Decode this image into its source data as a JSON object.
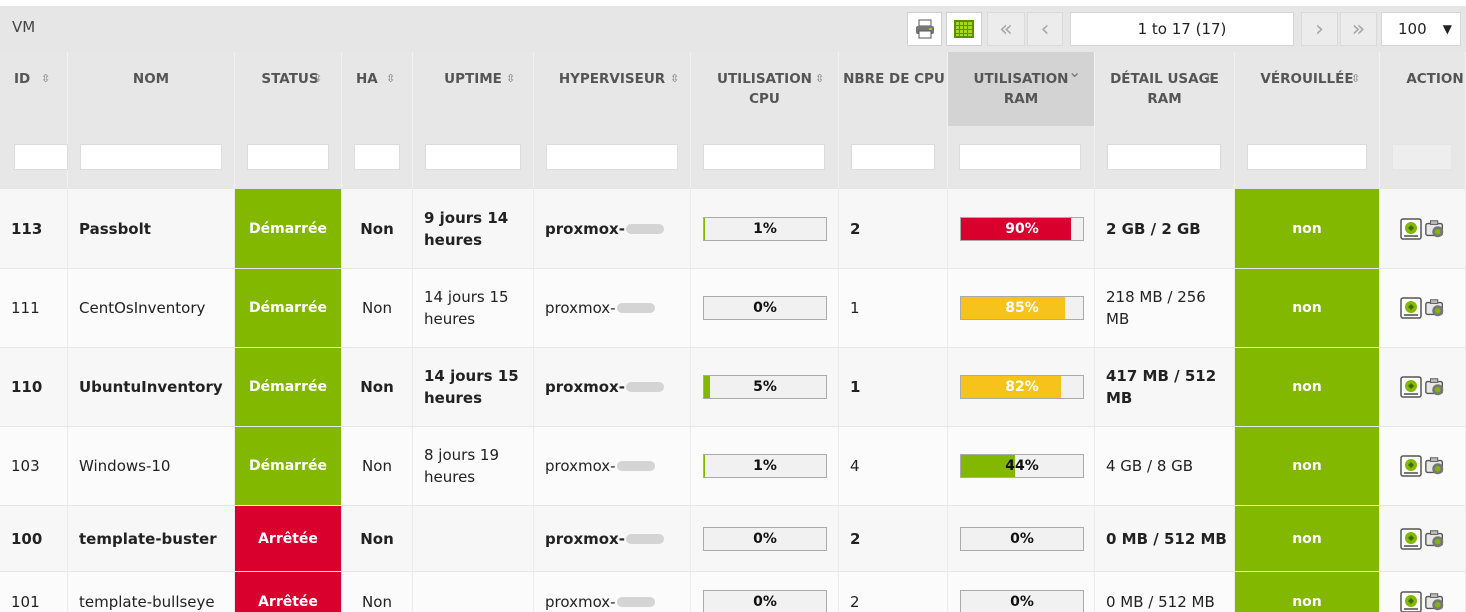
{
  "panel": {
    "title": "VM"
  },
  "toolbar": {
    "pager_text": "1 to 17 (17)",
    "per_page": "100",
    "icons": [
      "print-icon",
      "columns-icon",
      "first-page-icon",
      "prev-page-icon",
      "next-page-icon",
      "last-page-icon"
    ]
  },
  "columns": [
    {
      "label": "ID",
      "sortable": true
    },
    {
      "label": "NOM",
      "sortable": true
    },
    {
      "label": "STATUS",
      "sortable": true
    },
    {
      "label": "HA",
      "sortable": true
    },
    {
      "label": "UPTIME",
      "sortable": true
    },
    {
      "label": "HYPERVISEUR",
      "sortable": true
    },
    {
      "label": "UTILISATION CPU",
      "sortable": true
    },
    {
      "label": "NBRE DE CPU",
      "sortable": false
    },
    {
      "label": "UTILISATION RAM",
      "sortable": true,
      "sorted": "desc"
    },
    {
      "label": "DÉTAIL USAGE RAM",
      "sortable": true
    },
    {
      "label": "VÉROUILLÉE",
      "sortable": true
    },
    {
      "label": "ACTION",
      "sortable": false
    }
  ],
  "colors": {
    "green": "#82b800",
    "red": "#d9002d",
    "yellow": "#f7c31a"
  },
  "rows": [
    {
      "id": "113",
      "name": "Passbolt",
      "status": "Démarrée",
      "ha": "Non",
      "uptime": "9 jours 14 heures",
      "hypervisor": "proxmox-",
      "cpu_pct": 1,
      "cpu_label": "1%",
      "cpu_count": "2",
      "ram_pct": 90,
      "ram_label": "90%",
      "ram_detail": "2 GB / 2 GB",
      "locked": "non",
      "bold": true
    },
    {
      "id": "111",
      "name": "CentOsInventory",
      "status": "Démarrée",
      "ha": "Non",
      "uptime": "14 jours 15 heures",
      "hypervisor": "proxmox-",
      "cpu_pct": 0,
      "cpu_label": "0%",
      "cpu_count": "1",
      "ram_pct": 85,
      "ram_label": "85%",
      "ram_detail": "218 MB / 256 MB",
      "locked": "non",
      "bold": false
    },
    {
      "id": "110",
      "name": "UbuntuInventory",
      "status": "Démarrée",
      "ha": "Non",
      "uptime": "14 jours 15 heures",
      "hypervisor": "proxmox-",
      "cpu_pct": 5,
      "cpu_label": "5%",
      "cpu_count": "1",
      "ram_pct": 82,
      "ram_label": "82%",
      "ram_detail": "417 MB / 512 MB",
      "locked": "non",
      "bold": true
    },
    {
      "id": "103",
      "name": "Windows-10",
      "status": "Démarrée",
      "ha": "Non",
      "uptime": "8 jours 19 heures",
      "hypervisor": "proxmox-",
      "cpu_pct": 1,
      "cpu_label": "1%",
      "cpu_count": "4",
      "ram_pct": 44,
      "ram_label": "44%",
      "ram_detail": "4 GB / 8 GB",
      "locked": "non",
      "bold": false
    },
    {
      "id": "100",
      "name": "template-buster",
      "status": "Arrêtée",
      "ha": "Non",
      "uptime": "",
      "hypervisor": "proxmox-",
      "cpu_pct": 0,
      "cpu_label": "0%",
      "cpu_count": "2",
      "ram_pct": 0,
      "ram_label": "0%",
      "ram_detail": "0 MB / 512 MB",
      "locked": "non",
      "bold": true
    },
    {
      "id": "101",
      "name": "template-bullseye",
      "status": "Arrêtée",
      "ha": "Non",
      "uptime": "",
      "hypervisor": "proxmox-",
      "cpu_pct": 0,
      "cpu_label": "0%",
      "cpu_count": "2",
      "ram_pct": 0,
      "ram_label": "0%",
      "ram_detail": "0 MB / 512 MB",
      "locked": "non",
      "bold": false
    }
  ]
}
